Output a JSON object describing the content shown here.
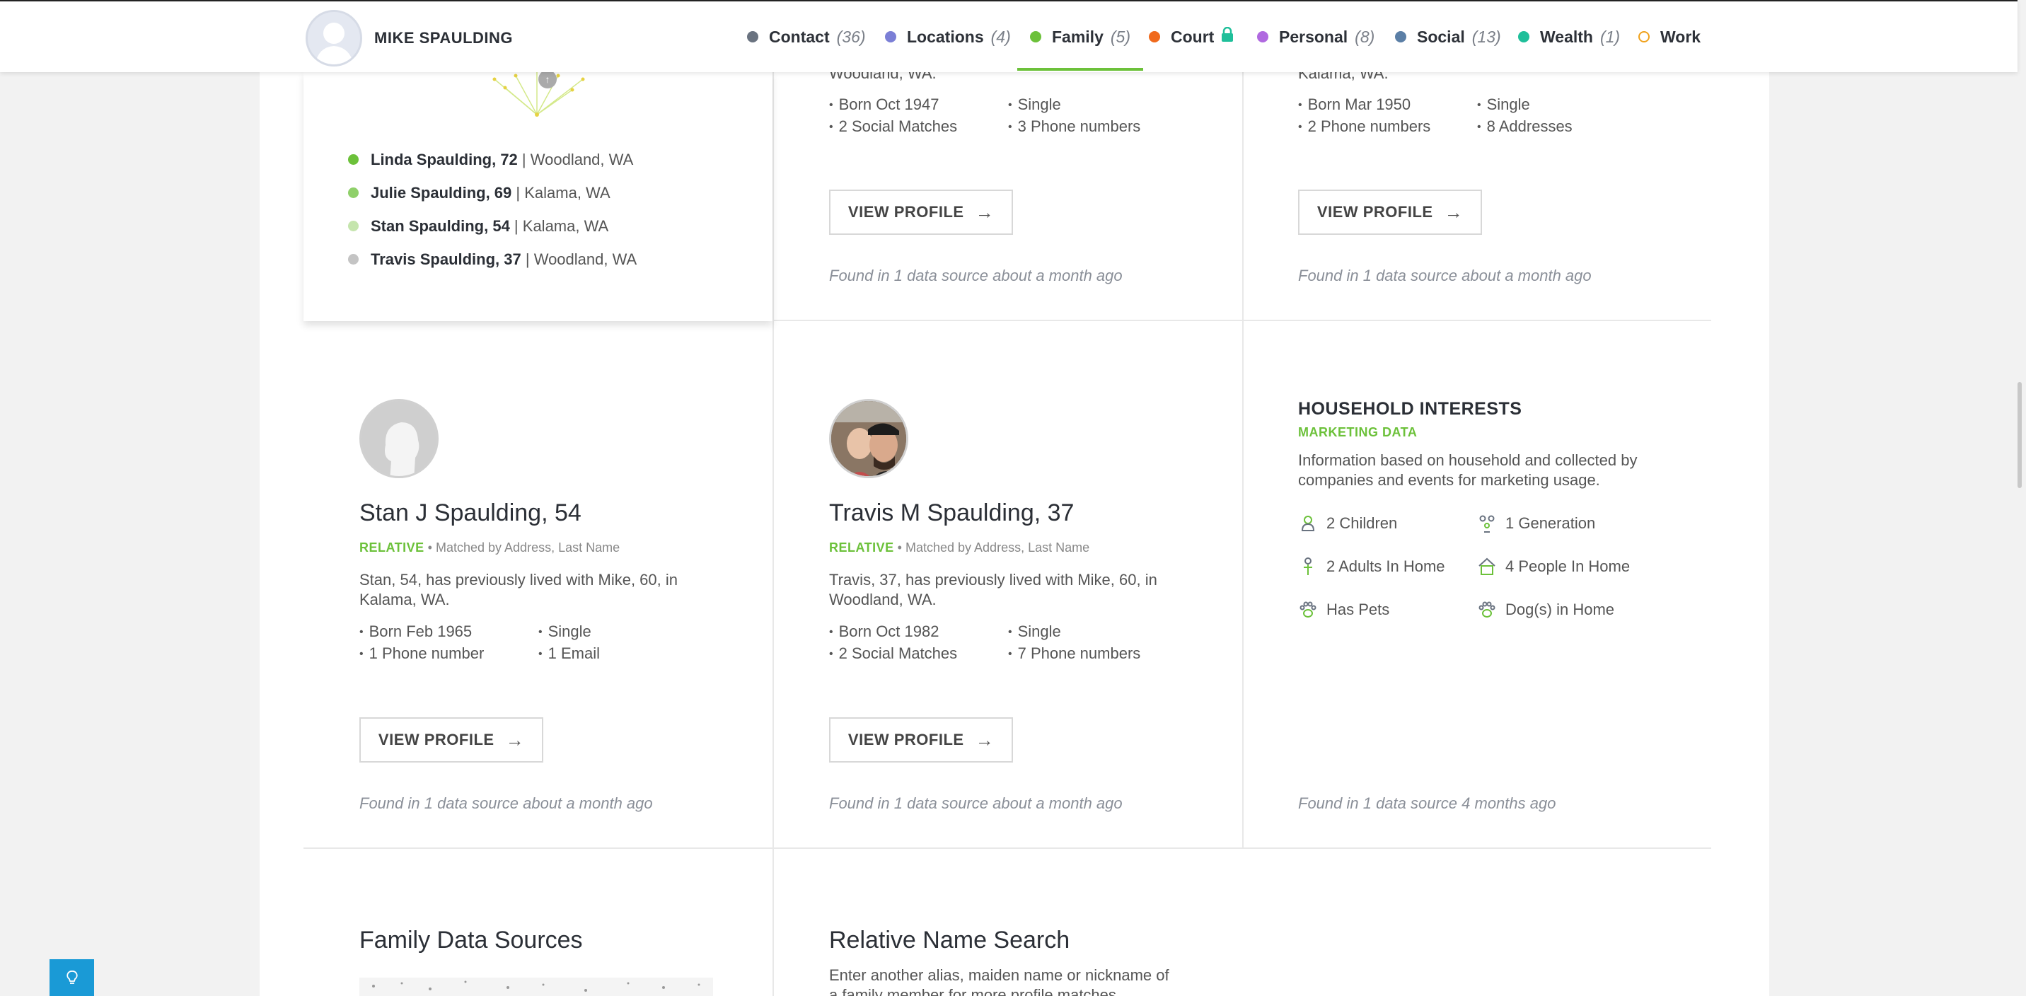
{
  "header": {
    "name": "MIKE SPAULDING",
    "nav": [
      {
        "label": "Contact",
        "count": "(36)",
        "color": "#6a7380"
      },
      {
        "label": "Locations",
        "count": "(4)",
        "color": "#7b7fd6"
      },
      {
        "label": "Family",
        "count": "(5)",
        "color": "#6cc13a"
      },
      {
        "label": "Court",
        "count": "",
        "color": "#f06a1d"
      },
      {
        "label": "Personal",
        "count": "(8)",
        "color": "#b069e0"
      },
      {
        "label": "Social",
        "count": "(13)",
        "color": "#5b7fa6"
      },
      {
        "label": "Wealth",
        "count": "(1)",
        "color": "#1fbf9a"
      },
      {
        "label": "Work",
        "count": "",
        "color": "#f0a21d"
      }
    ]
  },
  "family_summary": {
    "members": [
      {
        "name": "Linda Spaulding, 72",
        "location": "Woodland, WA",
        "color": "#6cc13a"
      },
      {
        "name": "Julie Spaulding, 69",
        "location": "Kalama, WA",
        "color": "#8fd06a"
      },
      {
        "name": "Stan Spaulding, 54",
        "location": "Kalama, WA",
        "color": "#c5e5ad"
      },
      {
        "name": "Travis Spaulding, 37",
        "location": "Woodland, WA",
        "color": "#c4c4c4"
      }
    ]
  },
  "top_cards": [
    {
      "desc_tail": "Woodland, WA.",
      "facts": [
        "Born Oct 1947",
        "Single",
        "2 Social Matches",
        "3 Phone numbers"
      ],
      "button": "VIEW PROFILE",
      "found": "Found in 1 data source about a month ago"
    },
    {
      "desc_tail": "Kalama, WA.",
      "facts": [
        "Born Mar 1950",
        "Single",
        "2 Phone numbers",
        "8 Addresses"
      ],
      "button": "VIEW PROFILE",
      "found": "Found in 1 data source about a month ago"
    }
  ],
  "relatives": [
    {
      "name": "Stan J Spaulding, 54",
      "tag": "RELATIVE",
      "match": "Matched by Address, Last Name",
      "desc_1": "Stan, 54, has previously lived with Mike, 60, in",
      "desc_2": "Kalama, WA.",
      "facts": [
        "Born Feb 1965",
        "Single",
        "1 Phone number",
        "1 Email"
      ],
      "button": "VIEW PROFILE",
      "found": "Found in 1 data source about a month ago"
    },
    {
      "name": "Travis M Spaulding, 37",
      "tag": "RELATIVE",
      "match": "Matched by Address, Last Name",
      "desc_1": "Travis, 37, has previously lived with Mike, 60, in",
      "desc_2": "Woodland, WA.",
      "facts": [
        "Born Oct 1982",
        "Single",
        "2 Social Matches",
        "7 Phone numbers"
      ],
      "button": "VIEW PROFILE",
      "found": "Found in 1 data source about a month ago"
    }
  ],
  "household": {
    "title": "HOUSEHOLD INTERESTS",
    "subtitle": "MARKETING DATA",
    "desc_1": "Information based on household and collected by",
    "desc_2": "companies and events for marketing usage.",
    "items": [
      {
        "label": "2 Children",
        "icon": "children-icon"
      },
      {
        "label": "1 Generation",
        "icon": "generation-icon"
      },
      {
        "label": "2 Adults In Home",
        "icon": "adult-icon"
      },
      {
        "label": "4 People In Home",
        "icon": "home-icon"
      },
      {
        "label": "Has Pets",
        "icon": "paw-icon"
      },
      {
        "label": "Dog(s) in Home",
        "icon": "paw-icon"
      }
    ],
    "found": "Found in 1 data source 4 months ago"
  },
  "sections": {
    "sources_title": "Family Data Sources",
    "search_title": "Relative Name Search",
    "search_desc_1": "Enter another alias, maiden name or nickname of",
    "search_desc_2": "a family member for more profile matches."
  }
}
